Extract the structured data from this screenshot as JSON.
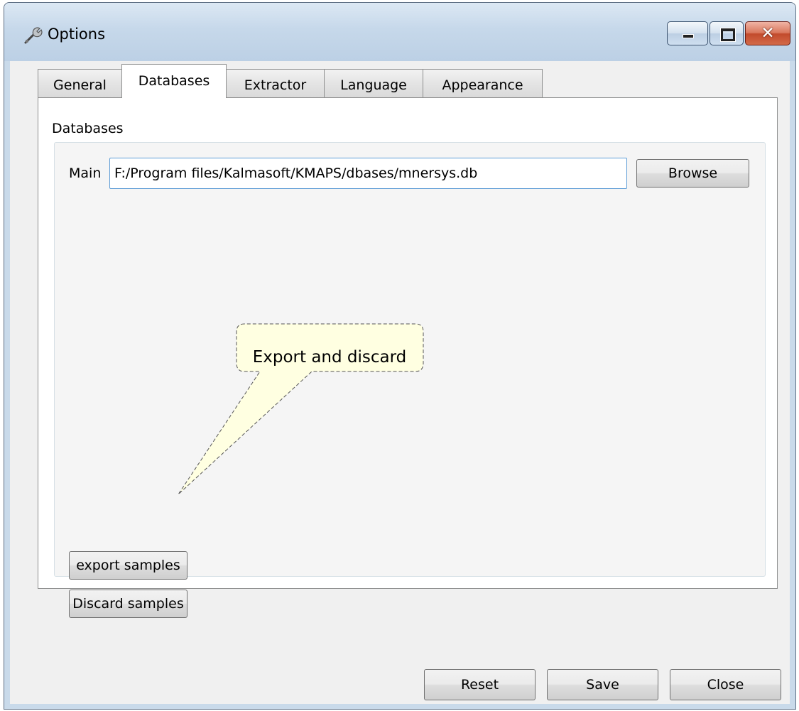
{
  "window": {
    "title": "Options",
    "icon": "wrench-icon",
    "controls": {
      "minimize": "minimize-icon",
      "maximize": "maximize-icon",
      "close": "close-icon"
    }
  },
  "tabs": [
    {
      "label": "General",
      "active": false
    },
    {
      "label": "Databases",
      "active": true
    },
    {
      "label": "Extractor",
      "active": false
    },
    {
      "label": "Language",
      "active": false
    },
    {
      "label": "Appearance",
      "active": false
    }
  ],
  "databases": {
    "group_label": "Databases",
    "main_label": "Main",
    "main_path": "F:/Program files/Kalmasoft/KMAPS/dbases/mnersys.db",
    "browse_label": "Browse",
    "export_label": "export samples",
    "discard_label": "Discard samples"
  },
  "callout": {
    "text": "Export and discard"
  },
  "footer": {
    "reset_label": "Reset",
    "save_label": "Save",
    "close_label": "Close"
  },
  "colors": {
    "title_bar": "#c6d8ea",
    "close_button": "#c24a2c",
    "tooltip_fill": "#ffffe1",
    "input_border": "#5e9dd6"
  }
}
